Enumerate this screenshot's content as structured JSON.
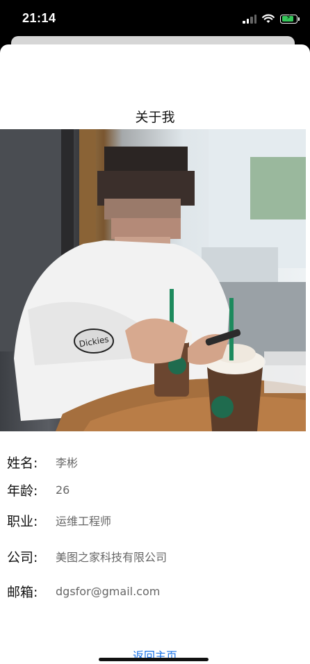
{
  "status_bar": {
    "time": "21:14",
    "icons": [
      "signal-icon",
      "wifi-icon",
      "battery-charging-icon"
    ],
    "battery_color": "#34c759"
  },
  "page": {
    "title": "关于我",
    "photo_alt": "profile photo"
  },
  "profile": {
    "fields": [
      {
        "label": "姓名:",
        "value": "李彬"
      },
      {
        "label": "年龄:",
        "value": "26"
      },
      {
        "label": "职业:",
        "value": "运维工程师"
      },
      {
        "label": "公司:",
        "value": "美图之家科技有限公司"
      },
      {
        "label": "邮箱:",
        "value": "dgsfor@gmail.com"
      }
    ]
  },
  "footer": {
    "home_link": "返回主页",
    "link_color": "#1a73e8"
  }
}
